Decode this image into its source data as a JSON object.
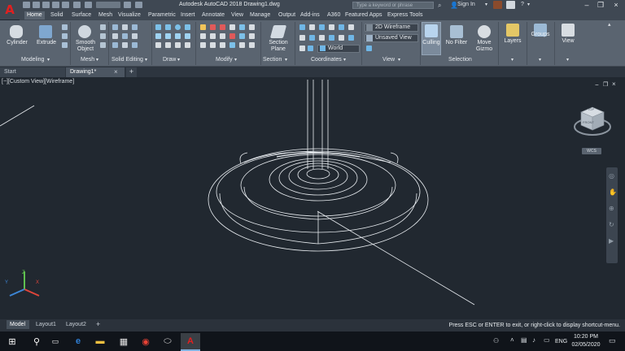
{
  "title_bar": {
    "title": "Autodesk AutoCAD 2018    Drawing1.dwg",
    "search_placeholder": "Type a keyword or phrase",
    "sign_in": "Sign In",
    "help": "?"
  },
  "ribbon_tabs": [
    "Home",
    "Solid",
    "Surface",
    "Mesh",
    "Visualize",
    "Parametric",
    "Insert",
    "Annotate",
    "View",
    "Manage",
    "Output",
    "Add-ins",
    "A360",
    "Featured Apps",
    "Express Tools"
  ],
  "active_tab": "Home",
  "ribbon": {
    "modeling": {
      "label": "Modeling",
      "cylinder": "Cylinder",
      "extrude": "Extrude"
    },
    "mesh": {
      "label": "Mesh",
      "smooth_object_1": "Smooth",
      "smooth_object_2": "Object"
    },
    "solid_editing": {
      "label": "Solid Editing"
    },
    "draw": {
      "label": "Draw"
    },
    "modify": {
      "label": "Modify"
    },
    "section": {
      "label": "Section",
      "section_plane_1": "Section",
      "section_plane_2": "Plane"
    },
    "coordinates": {
      "label": "Coordinates",
      "ucs_value": "World"
    },
    "view": {
      "label": "View",
      "visual_style": "2D Wireframe",
      "saved_view": "Unsaved View"
    },
    "selection": {
      "label": "Selection",
      "culling": "Culling",
      "no_filter": "No Filter",
      "move_gizmo_1": "Move",
      "move_gizmo_2": "Gizmo"
    },
    "layers": "Layers",
    "groups": "Groups",
    "view_panel": "View"
  },
  "doc_tabs": {
    "start": "Start",
    "drawing": "Drawing1*",
    "close": "×",
    "add": "+"
  },
  "viewport": {
    "label": "[−][Custom View][Wireframe]",
    "viewcube_top": "TOP",
    "viewcube_front": "FRONT",
    "wcs": "WCS",
    "ucs_x": "X",
    "ucs_y": "Y",
    "ucs_z": "Z",
    "window_controls": [
      "−",
      "❐",
      "×"
    ]
  },
  "layout_tabs": [
    "Model",
    "Layout1",
    "Layout2"
  ],
  "layout_add": "+",
  "command_prompt": "Press ESC or ENTER to exit, or right-click to display shortcut-menu.",
  "taskbar": {
    "time": "10:20 PM",
    "date": "02/05/2020",
    "lang": "ENG"
  }
}
